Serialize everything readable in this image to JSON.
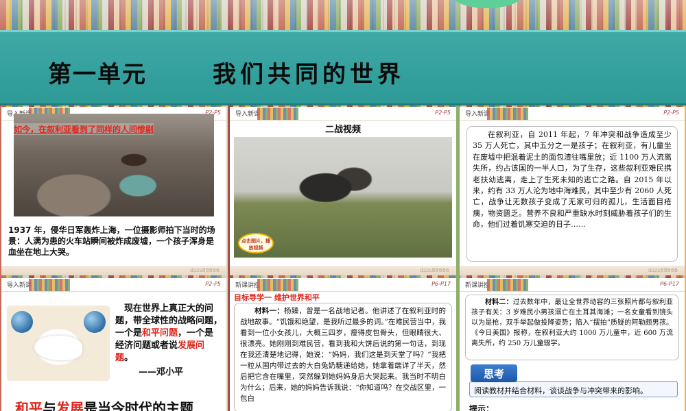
{
  "header": {
    "unit": "第一单元",
    "topic": "我们共同的世界"
  },
  "panels": {
    "p1": {
      "tag": "导入新课",
      "pages": "P2-P5",
      "overlay": "如今，在叙利亚看到了同样的人间惨剧",
      "caption": "1937 年，侵华日军轰炸上海，一位摄影师拍下当时的场景：人满为患的火车站瞬间被炸成废墟，一个孩子浑身是血坐在地上大哭。",
      "watermark": "dzzs88666"
    },
    "p2": {
      "tag": "导入新课",
      "pages": "P2-P5",
      "title": "二战视频",
      "play_button": "点击图片，播放视频",
      "watermark": "dzzs88666"
    },
    "p3": {
      "tag": "导入新课",
      "pages": "P2-P5",
      "text": "在叙利亚，自 2011 年起，7 年冲突和战争造成至少 35 万人死亡，其中五分之一是孩子；在叙利亚，有儿童坐在废墟中把混着泥土的面包渣往嘴里放；近 1100 万人流离失所，约占该国的一半人口，为了生存，这些叙利亚难民携老扶幼逃离，走上了生死未知的逃亡之路。自 2015 年以来，约有 33 万人沦为地中海难民，其中至少有 2060 人死亡，战争让无数孩子变成了无家可归的孤儿，生活面目疮痍，物资匮乏。营养不良和严重缺水时刻威胁着孩子们的生命，他们过着饥寒交迫的日子……",
      "watermark": "dzzs88666"
    },
    "p4": {
      "tag": "导入新课",
      "pages": "P2-P5",
      "quote_pre": "现在世界上真正大的问题，带全球性的战略问题，一个是",
      "quote_peace": "和平问题",
      "quote_mid": "，一个是经济问题或者说",
      "quote_dev": "发展问题",
      "quote_end": "。",
      "author": "——邓小平",
      "theme_peace": "和平",
      "theme_and": "与",
      "theme_dev": "发展",
      "theme_rest": "是当今时代的主题",
      "watermark": "dzzs88666"
    },
    "p5": {
      "tag": "新课讲授",
      "pages": "P6-P17",
      "goal": "目标导学一  维护世界和平",
      "material_label": "材料一：",
      "material_text": "杨臻，曾是一名战地记者。他讲述了在叙利亚时的战地故事。“饥饿和绝望，是我听过最多的词。”在难民营当中，我看到一位小女孩儿，大概三四岁，瘦得皮包骨头，但眼睛很大、很漂亮。她刚刚到难民营，看到我和大饼后说的第一句话，到现在我还清楚地记得，她说：“妈妈，我们这是到天堂了吗？”我把一粒从国内带过去的大白兔奶糖递给她，她拿着端详了半天，然后把它含在嘴里，突然躲到她妈妈身后大哭起来。我当时不明白为什么；后来，她的妈妈告诉我说：“你知道吗？在交战区里，一包白"
    },
    "p6": {
      "tag": "新课讲授",
      "pages": "P6-P17",
      "material_label": "材料二：",
      "material_text": "过去数年中，最让全世界动容的三张照片都与叙利亚孩子有关：3 岁难民小男孩溺亡在土耳其海滩；一名女童看到镜头以为是枪，双手举起做投降姿势；陷入“摆拍”质疑的阿勒颇男孩。《今日美国》报称，在叙利亚大约 1000 万儿童中，近 600 万流离失所，约 250 万儿童辍学。",
      "think_label": "思考",
      "think_text": "阅读教材并结合材料，谈谈战争与冲突带来的影响。",
      "hint": "提示："
    }
  },
  "colors": {
    "band": "#2d9a97",
    "accent_red": "#e0261c",
    "think_blue": "#1f57a8"
  },
  "icons": [
    "dove-icon",
    "globe-icon",
    "play-icon"
  ]
}
